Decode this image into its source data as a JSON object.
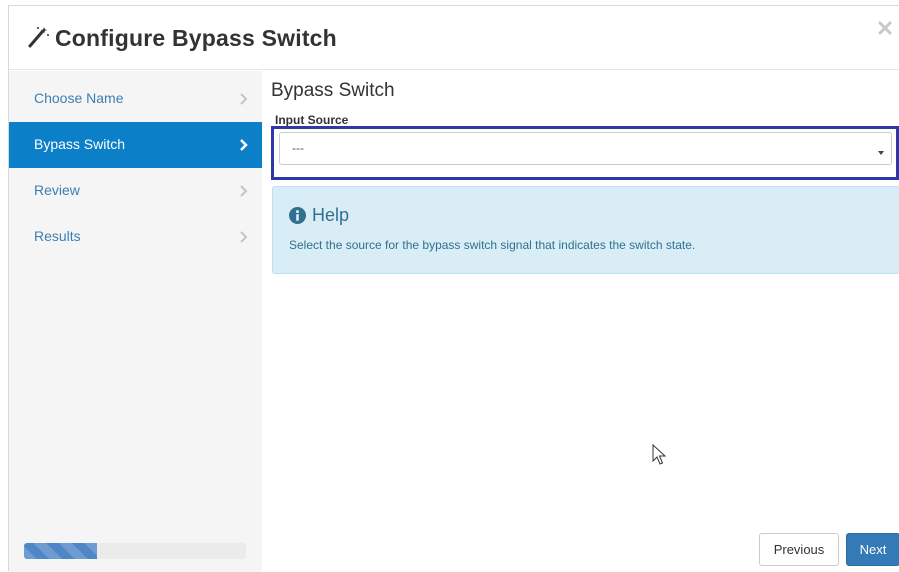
{
  "dialog": {
    "title": "Configure Bypass Switch",
    "title_icon": "magic-wand-icon",
    "close_icon": "close-icon"
  },
  "steps": [
    {
      "label": "Choose Name",
      "active": false
    },
    {
      "label": "Bypass Switch",
      "active": true
    },
    {
      "label": "Review",
      "active": false
    },
    {
      "label": "Results",
      "active": false
    }
  ],
  "progress": {
    "fraction": 0.33
  },
  "main": {
    "section_title": "Bypass Switch",
    "field_label": "Input Source",
    "select_value": "---"
  },
  "help": {
    "title": "Help",
    "text": "Select the source for the bypass switch signal that indicates the switch state."
  },
  "footer": {
    "previous_label": "Previous",
    "next_label": "Next"
  },
  "colors": {
    "active_step": "#0b7fc7",
    "step_link": "#3c7fb5",
    "highlight_border": "#2e38a8",
    "help_bg": "#d9edf7",
    "help_text": "#31708f",
    "primary_button": "#337ab7"
  }
}
